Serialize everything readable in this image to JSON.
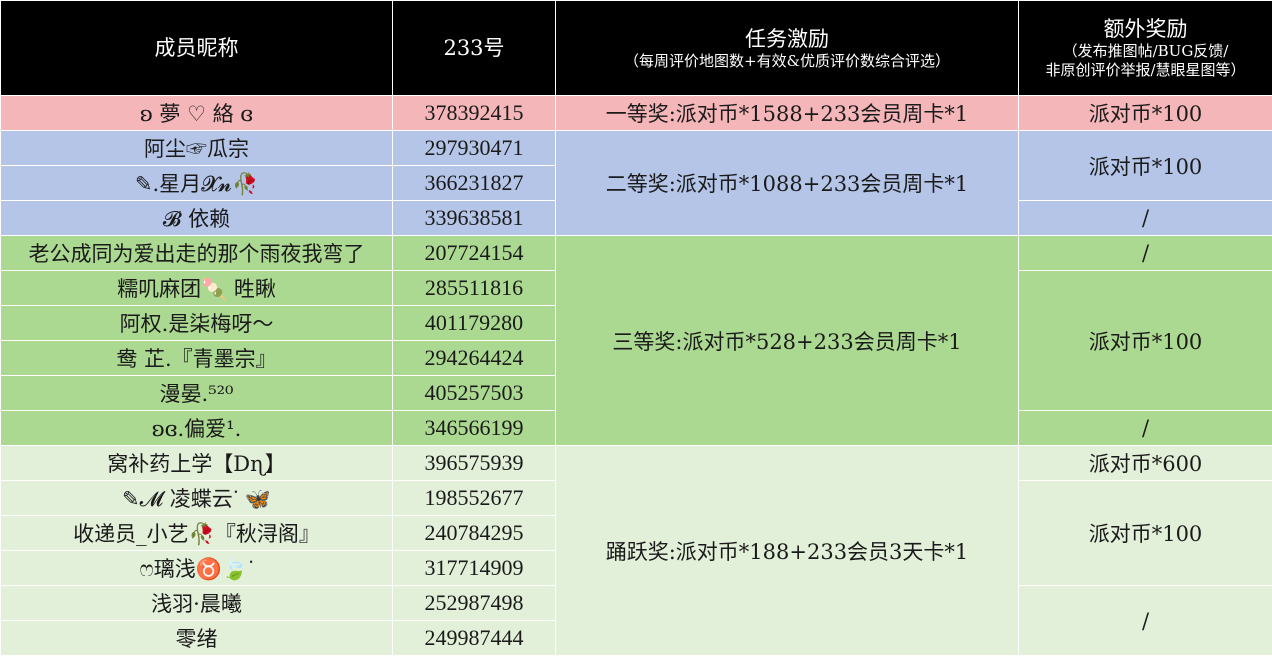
{
  "headers": {
    "name": "成员昵称",
    "id": "233号",
    "task": "任务激励",
    "task_sub": "（每周评价地图数+有效&优质评价数综合评选）",
    "extra": "额外奖励",
    "extra_sub1": "（发布推图帖/BUG反馈/",
    "extra_sub2": "非原创评价举报/慧眼星图等）"
  },
  "rows": [
    {
      "name": "ʚ 夢 ♡ 絡 ɞ",
      "id": "378392415"
    },
    {
      "name": "阿尘☞瓜宗",
      "id": "297930471"
    },
    {
      "name": "✎.星月𝓧𝓷🥀",
      "id": "366231827"
    },
    {
      "name": "𝓑 依赖",
      "id": "339638581"
    },
    {
      "name": "老公成同为爱出走的那个雨夜我弯了",
      "id": "207724154"
    },
    {
      "name": "糯叽麻团🍡 甠瞅",
      "id": "285511816"
    },
    {
      "name": "阿权.是柒梅呀～",
      "id": "401179280"
    },
    {
      "name": "鸯 芷.『青墨宗』",
      "id": "294264424"
    },
    {
      "name": "漫晏.⁵²⁰",
      "id": "405257503"
    },
    {
      "name": "ʚɞ.偏爱¹.",
      "id": "346566199"
    },
    {
      "name": "窝补药上学【Dɳ】",
      "id": "396575939"
    },
    {
      "name": "✎𝓜 凌蝶云ᐝ 🦋",
      "id": "198552677"
    },
    {
      "name": "收递员_小艺🥀『秋浔阁』",
      "id": "240784295"
    },
    {
      "name": "ෆ璃浅♉🍃ᐝ",
      "id": "317714909"
    },
    {
      "name": "浅羽·晨曦",
      "id": "252987498"
    },
    {
      "name": "零绪",
      "id": "249987444"
    }
  ],
  "tiers": {
    "first": "一等奖:派对币*1588+233会员周卡*1",
    "second": "二等奖:派对币*1088+233会员周卡*1",
    "third": "三等奖:派对币*528+233会员周卡*1",
    "active": "踊跃奖:派对币*188+233会员3天卡*1"
  },
  "extras": {
    "e1": "派对币*100",
    "e2": "派对币*100",
    "e3": "/",
    "e4": "/",
    "e5": "派对币*100",
    "e6": "/",
    "e7": "派对币*600",
    "e8": "派对币*100",
    "e9": "/"
  },
  "colors": {
    "header_bg": "#000000",
    "first_tier": "#f4b6b8",
    "second_tier": "#b4c5e8",
    "third_tier": "#acd991",
    "active_tier": "#e2efd9"
  }
}
